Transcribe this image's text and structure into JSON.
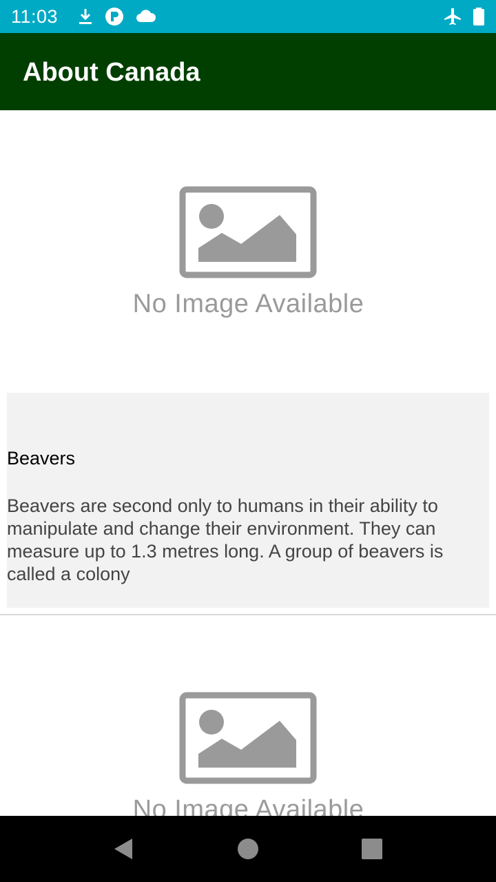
{
  "status_bar": {
    "time": "11:03",
    "icons_left": [
      "download-icon",
      "p-app-icon",
      "cloud-icon"
    ],
    "icons_right": [
      "airplane-mode-icon",
      "battery-icon"
    ]
  },
  "app_bar": {
    "title": "About Canada",
    "color": "#003f00"
  },
  "items": [
    {
      "image_placeholder_text": "No Image Available",
      "title": "Beavers",
      "description": "Beavers are second only to humans in their ability to manipulate and change their environment. They can measure up to 1.3 metres long. A group of beavers is called a colony"
    },
    {
      "image_placeholder_text": "No Image Available"
    }
  ],
  "nav_bar": {
    "buttons": [
      "back-icon",
      "home-icon",
      "recents-icon"
    ]
  },
  "colors": {
    "status_bar": "#00aac4",
    "card_background": "#f2f2f2"
  }
}
